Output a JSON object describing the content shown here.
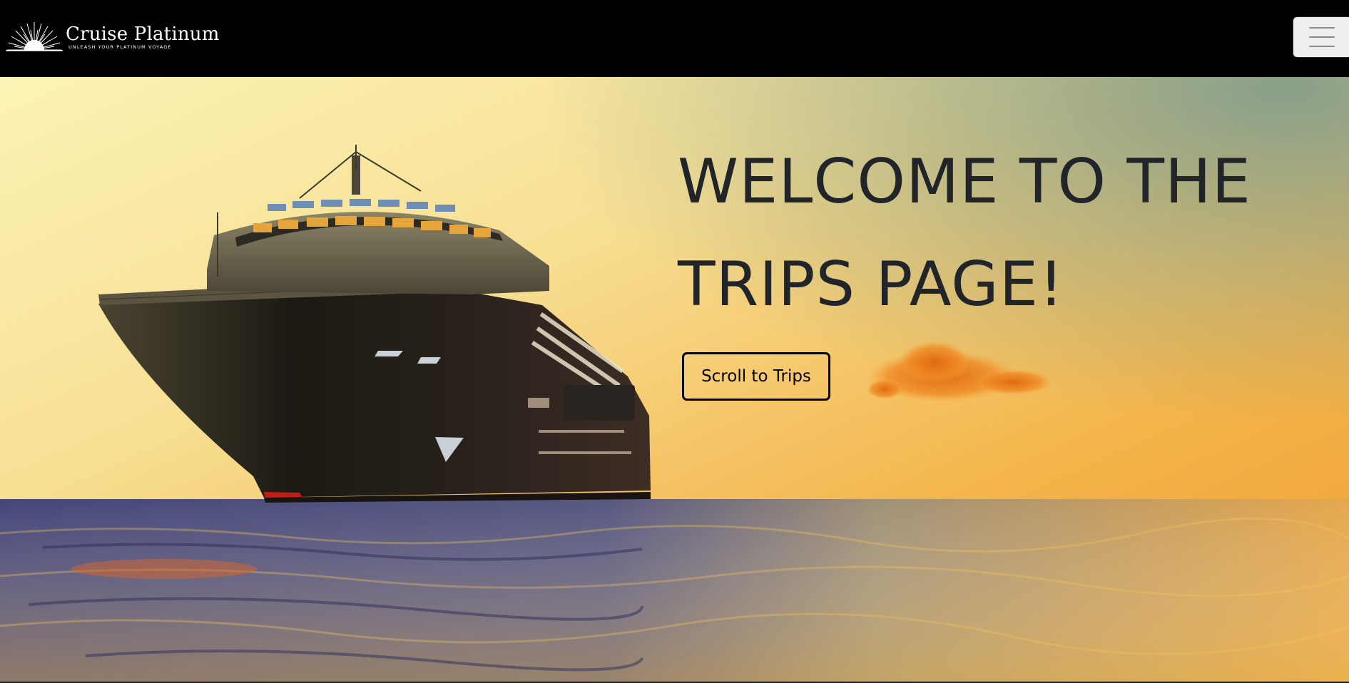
{
  "navbar": {
    "brand_name": "Cruise Platinum",
    "brand_tagline": "UNLEASH YOUR PLATINUM VOYAGE",
    "logo_icon": "sunburst-logo",
    "menu_icon": "hamburger-menu-icon"
  },
  "hero": {
    "title_line1": "WELCOME TO THE",
    "title_line2": "TRIPS PAGE!",
    "button_label": "Scroll to Trips",
    "background_image": "cruise-ship-at-sunset"
  },
  "colors": {
    "navbar_bg": "#000000",
    "brand_text": "#ffffff",
    "hero_title": "#212529",
    "button_border": "#000000",
    "sky_top": "#fbf1b0",
    "sky_bottom": "#eda032",
    "sea": "#3a3f6e"
  }
}
